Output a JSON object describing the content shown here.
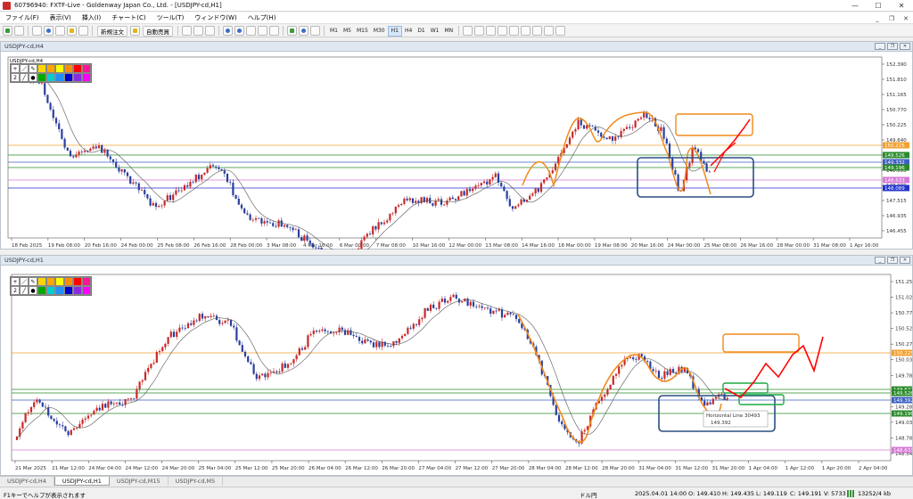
{
  "window": {
    "title": "60796940: FXTF-Live - Goldenway Japan Co., Ltd. - [USDJPY-cd,H1]",
    "controls": [
      "—",
      "☐",
      "✕"
    ]
  },
  "menu": {
    "items": [
      "ファイル(F)",
      "表示(V)",
      "挿入(I)",
      "チャート(C)",
      "ツール(T)",
      "ウィンドウ(W)",
      "ヘルプ(H)"
    ],
    "mdi_controls": [
      "_",
      "❐",
      "✕"
    ]
  },
  "toolbar": {
    "new_order": "新規注文",
    "auto_trade": "自動売買",
    "timeframes": [
      "M1",
      "M5",
      "M15",
      "M30",
      "H1",
      "H4",
      "D1",
      "W1",
      "MN"
    ],
    "active_timeframe": "H1"
  },
  "chart_top": {
    "window_title": "USDJPY-cd,H4",
    "label": "USDJPY-cd,H4",
    "palette_number": "2",
    "price_ticks": [
      "152.390",
      "151.810",
      "151.165",
      "150.770",
      "150.225",
      "149.640",
      "149.196",
      "148.633",
      "148.089",
      "147.515",
      "146.935",
      "146.455"
    ],
    "price_labels": [
      {
        "value": "150.225",
        "color": "#f0a030"
      },
      {
        "value": "149.526",
        "color": "#2a8a2a"
      },
      {
        "value": "149.332",
        "color": "#3e5fc2"
      },
      {
        "value": "149.196",
        "color": "#2a8a2a"
      },
      {
        "value": "148.633",
        "color": "#d57ad5"
      },
      {
        "value": "148.089",
        "color": "#2233cc"
      }
    ],
    "time_labels": [
      "18 Feb 2025",
      "19 Feb 08:00",
      "20 Feb 16:00",
      "24 Feb 00:00",
      "25 Feb 08:00",
      "26 Feb 16:00",
      "28 Feb 00:00",
      "3 Mar 08:00",
      "4 Mar 16:00",
      "6 Mar 00:00",
      "7 Mar 08:00",
      "10 Mar 16:00",
      "12 Mar 00:00",
      "13 Mar 08:00",
      "14 Mar 16:00",
      "18 Mar 00:00",
      "19 Mar 08:00",
      "20 Mar 16:00",
      "24 Mar 00:00",
      "25 Mar 08:00",
      "26 Mar 16:00",
      "28 Mar 00:00",
      "31 Mar 08:00",
      "1 Apr 16:00"
    ]
  },
  "chart_bottom": {
    "window_title": "USDJPY-cd,H1",
    "label": "USDJPY-cd,H1",
    "palette_number": "2",
    "price_ticks": [
      "151.250",
      "151.020",
      "150.775",
      "150.525",
      "150.275",
      "150.030",
      "149.780",
      "149.535",
      "149.285",
      "149.035",
      "148.785",
      "148.540"
    ],
    "price_labels": [
      {
        "value": "150.225",
        "color": "#f0a030"
      },
      {
        "value": "149.622",
        "color": "#2a8a2a"
      },
      {
        "value": "149.526",
        "color": "#2a8a2a"
      },
      {
        "value": "149.392",
        "color": "#3e5fc2"
      },
      {
        "value": "149.196",
        "color": "#2a8a2a"
      },
      {
        "value": "148.633",
        "color": "#d57ad5"
      }
    ],
    "time_labels": [
      "21 Mar 2025",
      "21 Mar 12:00",
      "24 Mar 04:00",
      "24 Mar 12:00",
      "24 Mar 20:00",
      "25 Mar 04:00",
      "25 Mar 12:00",
      "25 Mar 20:00",
      "26 Mar 04:00",
      "26 Mar 12:00",
      "26 Mar 20:00",
      "27 Mar 04:00",
      "27 Mar 12:00",
      "27 Mar 20:00",
      "28 Mar 04:00",
      "28 Mar 12:00",
      "28 Mar 20:00",
      "31 Mar 04:00",
      "31 Mar 12:00",
      "31 Mar 20:00",
      "1 Apr 04:00",
      "1 Apr 12:00",
      "1 Apr 20:00",
      "2 Apr 04:00"
    ],
    "tooltip_line1": "Horizontal Line 30493",
    "tooltip_line2": "149.392"
  },
  "tabs": [
    {
      "label": "USDJPY-cd,H4",
      "active": false
    },
    {
      "label": "USDJPY-cd,H1",
      "active": true
    },
    {
      "label": "USDJPY-cd,M15",
      "active": false
    },
    {
      "label": "USDJPY-cd,M5",
      "active": false
    }
  ],
  "status": {
    "help": "F1キーでヘルプが表示されます",
    "symbol": "ドル円",
    "datetime": "2025.04.01 14:00",
    "open": "O: 149.410",
    "high": "H: 149.435",
    "low": "L: 149.119",
    "close": "C: 149.191",
    "volume": "V: 5733",
    "traffic": "13252/4 kb"
  },
  "colors": {
    "bull": "#c82828",
    "bear": "#2a3f9e",
    "ma": "#555555",
    "orange_level": "#f0a030",
    "green_level": "#2a8a2a",
    "blue_level": "#3e5fc2",
    "magenta_level": "#d57ad5",
    "navy_level": "#2233cc"
  }
}
